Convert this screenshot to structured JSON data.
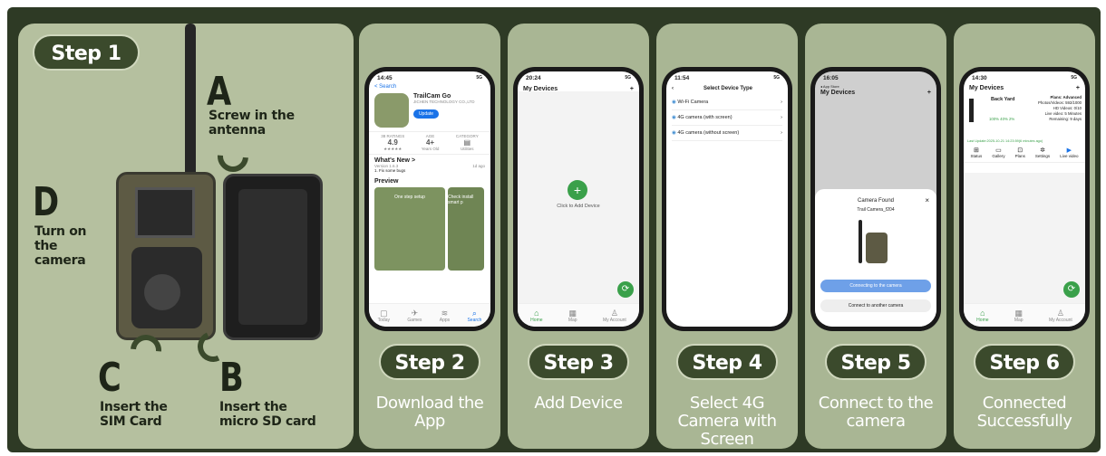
{
  "step1": {
    "badge": "Step 1",
    "A": "A",
    "A_text": "Screw in the antenna",
    "B": "B",
    "B_text": "Insert the micro SD card",
    "C": "C",
    "C_text": "Insert the SIM Card",
    "D": "D",
    "D_text": "Turn on the camera"
  },
  "steps": [
    {
      "badge": "Step 2",
      "caption": "Download the App"
    },
    {
      "badge": "Step 3",
      "caption": "Add Device"
    },
    {
      "badge": "Step 4",
      "caption": "Select 4G Camera with Screen"
    },
    {
      "badge": "Step 5",
      "caption": "Connect to the camera"
    },
    {
      "badge": "Step 6",
      "caption": "Connected Successfully"
    }
  ],
  "phone2": {
    "time": "14:45",
    "signal": "5G",
    "back": "< Search",
    "app_name": "TrailCam Go",
    "developer": "JICHEN TECHNOLOGY CO.,LTD",
    "update": "Update",
    "ratings_label": "38 RATINGS",
    "rating": "4.9",
    "stars": "★★★★★",
    "age_label": "AGE",
    "age": "4+",
    "age_sub": "Years Old",
    "cat_label": "CATEGORY",
    "cat_sub": "Utilities",
    "whats_new": "What's New >",
    "version": "Version 1.6.3",
    "ago": "1d ago",
    "fix": "1. Fix some bugs",
    "preview": "Preview",
    "shot1": "One step setup",
    "shot2": "Check install smart p",
    "tabs": [
      "Today",
      "Games",
      "Apps",
      "Search"
    ]
  },
  "phone3": {
    "time": "20:24",
    "signal": "5G",
    "title": "My Devices",
    "plus": "+",
    "add": "Click to Add Device",
    "tabs": [
      "Home",
      "Map",
      "My Account"
    ]
  },
  "phone4": {
    "time": "11:54",
    "signal": "5G",
    "title": "Select Device Type",
    "items": [
      "Wi-Fi Camera",
      "4G camera (with screen)",
      "4G camera (without screen)"
    ]
  },
  "phone5": {
    "time": "16:05",
    "signal": "",
    "sub": "◂ App Store",
    "title": "My Devices",
    "plus": "+",
    "found": "Camera Found",
    "name": "Trail Camera_f204",
    "connecting": "Connecting to the camera",
    "another": "Connect to another camera"
  },
  "phone6": {
    "time": "14:30",
    "signal": "5G",
    "title": "My Devices",
    "plus": "+",
    "device": "Back Yard",
    "plan": "Plans: Advanced",
    "photos": "Photos/Videos: 592/1000",
    "hd": "HD Videos: 0/10",
    "live": "Live video: 5 Minutes",
    "remain": "Remaining: 9 days",
    "stats": "100%  40%  2%",
    "last": "Last Update:2025-10-21 14:23:59(6 minutes ago)",
    "actions": [
      "Status",
      "Gallery",
      "Plans",
      "Settings",
      "Live video"
    ],
    "tabs": [
      "Home",
      "Map",
      "My Account"
    ]
  }
}
